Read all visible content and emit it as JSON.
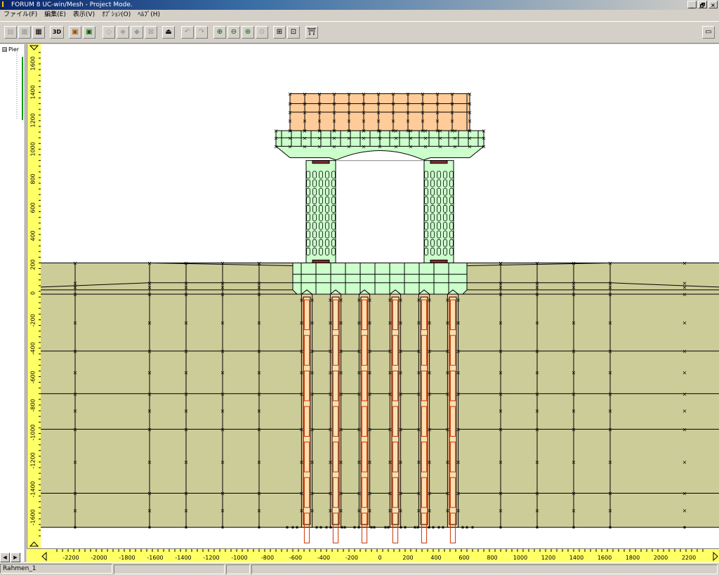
{
  "window": {
    "app_icon": "I-beam-logo",
    "title": "FORUM 8   UC-win/Mesh - Project Mode.",
    "controls": [
      "_",
      "🗗",
      "×"
    ]
  },
  "menu": [
    "ファイル(F)",
    "編集(E)",
    "表示(V)",
    "ｵﾌﾟｼｮﾝ(O)",
    "ﾍﾙﾌﾟ(H)"
  ],
  "toolbar": {
    "btn_3d": "3D",
    "icons": [
      "save-icon",
      "grid-icon",
      "table-icon",
      "3d-view",
      "render-icon",
      "image-icon",
      "node-icon",
      "node-add-icon",
      "node-delete-icon",
      "element-icon",
      "upload-icon",
      "undo-icon",
      "redo-icon",
      "zoom-in-icon",
      "zoom-out-icon",
      "zoom-fit-icon",
      "zoom-window-icon",
      "fit-all-icon",
      "frame-icon",
      "pier-icon",
      "window-icon"
    ]
  },
  "tree": {
    "root_toggle": "⊟",
    "root_label": "Pier"
  },
  "y_axis": {
    "labels": [
      "1600",
      "1400",
      "1200",
      "1000",
      "800",
      "600",
      "400",
      "200",
      "0",
      "-200",
      "-400",
      "-600",
      "-800",
      "-1000",
      "-1200",
      "-1400",
      "-1600"
    ]
  },
  "x_axis": {
    "labels": [
      "-2200",
      "-2000",
      "-1800",
      "-1600",
      "-1400",
      "-1200",
      "-1000",
      "-800",
      "-600",
      "-400",
      "-200",
      "0",
      "200",
      "400",
      "600",
      "800",
      "1000",
      "1200",
      "1400",
      "1600",
      "1800",
      "2000",
      "2200"
    ]
  },
  "mesh": {
    "colors": {
      "ground": "#cccc99",
      "footing": "#ccffcc",
      "beam": "#ffcc99",
      "pile": "#ffcc99",
      "line": "#000000",
      "pile_inner": "#cc3300"
    }
  },
  "status": {
    "model_name": "Rahmen_1",
    "scroll_left": "◀",
    "scroll_right": "▶"
  }
}
